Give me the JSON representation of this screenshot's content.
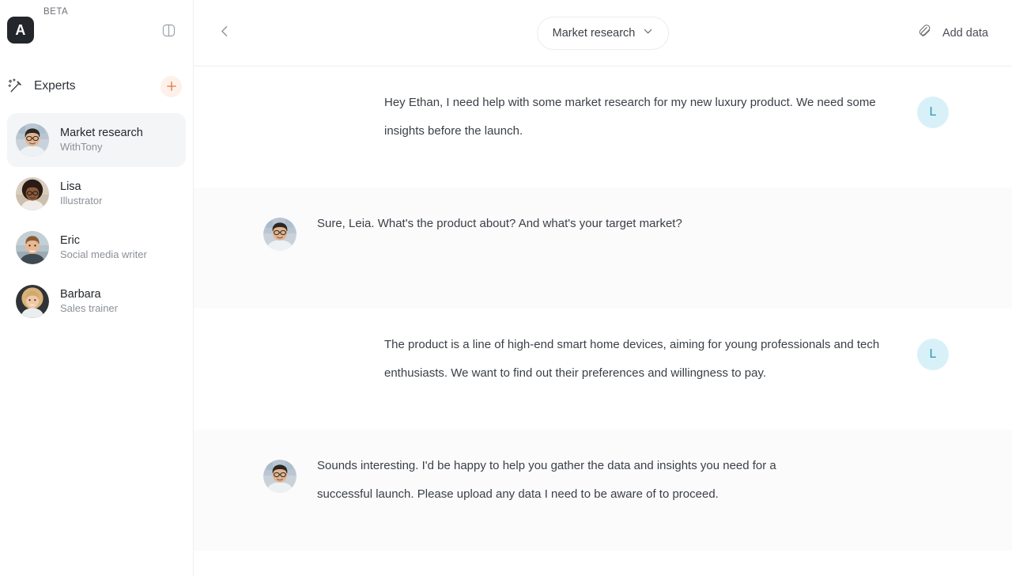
{
  "sidebar": {
    "logo_letter": "A",
    "beta_label": "BETA",
    "panel_toggle_icon": "sidebar-toggle-icon",
    "section_title": "Experts",
    "section_icon": "magic-wand-icon",
    "add_button_icon": "plus-icon",
    "experts": [
      {
        "name": "Market research",
        "role": "WithTony",
        "active": true,
        "avatar": "avatar-tony"
      },
      {
        "name": "Lisa",
        "role": "Illustrator",
        "active": false,
        "avatar": "avatar-lisa"
      },
      {
        "name": "Eric",
        "role": "Social media writer",
        "active": false,
        "avatar": "avatar-eric"
      },
      {
        "name": "Barbara",
        "role": "Sales trainer",
        "active": false,
        "avatar": "avatar-barbara"
      }
    ]
  },
  "topbar": {
    "back_icon": "chevron-left-icon",
    "chat_name": "Market research",
    "chat_caret_icon": "chevron-down-icon",
    "add_data_label": "Add data",
    "add_data_icon": "paperclip-icon"
  },
  "conversation": [
    {
      "role": "user",
      "avatar_initial": "L",
      "text": "Hey Ethan, I need help with some market research for my new luxury product. We need some insights before the launch."
    },
    {
      "role": "assistant",
      "avatar": "avatar-tony",
      "text": "Sure, Leia. What's the product about? And what's your target market?"
    },
    {
      "role": "user",
      "avatar_initial": "L",
      "text": "The product is a line of high-end smart home devices, aiming for young professionals and tech enthusiasts. We want to find out their preferences and willingness to pay."
    },
    {
      "role": "assistant",
      "avatar": "avatar-tony",
      "text": "Sounds interesting. I'd be happy to help you gather the data and insights you need for a successful launch. Please upload any data I need to be aware of to proceed."
    }
  ],
  "colors": {
    "accent_plus": "#e07a43",
    "logo_bg": "#23262b",
    "user_avatar_bg": "#d8f1f8",
    "user_avatar_fg": "#2f94b8",
    "assistant_row_bg": "#fbfbfc",
    "active_item_bg": "#f4f5f6"
  }
}
